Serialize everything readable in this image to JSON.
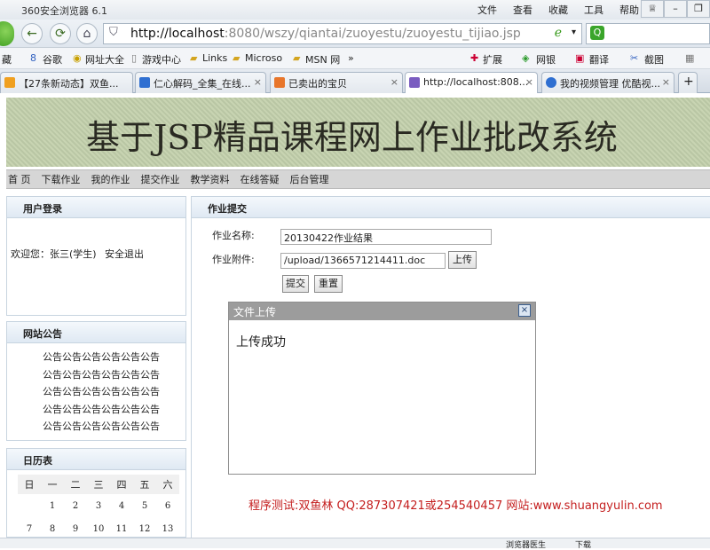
{
  "browser": {
    "title": "360安全浏览器 6.1",
    "menus": [
      "文件",
      "查看",
      "收藏",
      "工具",
      "帮助"
    ],
    "address": {
      "host": "http://localhost",
      "rest": ":8080/wszy/qiantai/zuoyestu/zuoyestu_tijiao.jsp"
    },
    "bookmarks": [
      "藏",
      "谷歌",
      "网址大全",
      "游戏中心",
      "Links",
      "Microso",
      "MSN 网"
    ],
    "toolbar_right": [
      "扩展",
      "网银",
      "翻译",
      "截图"
    ],
    "tabs": [
      {
        "label": "【27条新动态】双鱼...",
        "color": "#f0a020"
      },
      {
        "label": "仁心解码_全集_在线...",
        "color": "#2f6fd1"
      },
      {
        "label": "已卖出的宝贝",
        "color": "#e8762b"
      },
      {
        "label": "http://localhost:808...",
        "color": "#7a5cc0"
      },
      {
        "label": "我的视频管理 优酷视...",
        "color": "#2f6fd1"
      }
    ]
  },
  "site": {
    "banner_title": "基于JSP精品课程网上作业批改系统",
    "nav": [
      "首 页",
      "下载作业",
      "我的作业",
      "提交作业",
      "教学资料",
      "在线答疑",
      "后台管理"
    ]
  },
  "login": {
    "title": "用户登录",
    "welcome": "欢迎您：张三(学生)",
    "logout": "安全退出"
  },
  "notice": {
    "title": "网站公告",
    "lines": [
      "公告公告公告公告公告公告",
      "公告公告公告公告公告公告",
      "公告公告公告公告公告公告",
      "公告公告公告公告公告公告",
      "公告公告公告公告公告公告"
    ]
  },
  "calendar": {
    "title": "日历表",
    "weekdays": [
      "日",
      "一",
      "二",
      "三",
      "四",
      "五",
      "六"
    ],
    "row1": [
      "",
      "1",
      "2",
      "3",
      "4",
      "5",
      "6"
    ],
    "row2": [
      "7",
      "8",
      "9",
      "10",
      "11",
      "12",
      "13"
    ]
  },
  "submit": {
    "title": "作业提交",
    "name_label": "作业名称:",
    "name_value": "20130422作业结果",
    "attach_label": "作业附件:",
    "attach_value": "/upload/1366571214411.doc",
    "upload_btn": "上传",
    "submit_btn": "提交",
    "reset_btn": "重置"
  },
  "dialog": {
    "title": "文件上传",
    "close": "×",
    "message": "上传成功"
  },
  "footer": "程序测试:双鱼林 QQ:287307421或254540457 网站:www.shuangyulin.com",
  "status": [
    "浏览器医生",
    "下载"
  ]
}
